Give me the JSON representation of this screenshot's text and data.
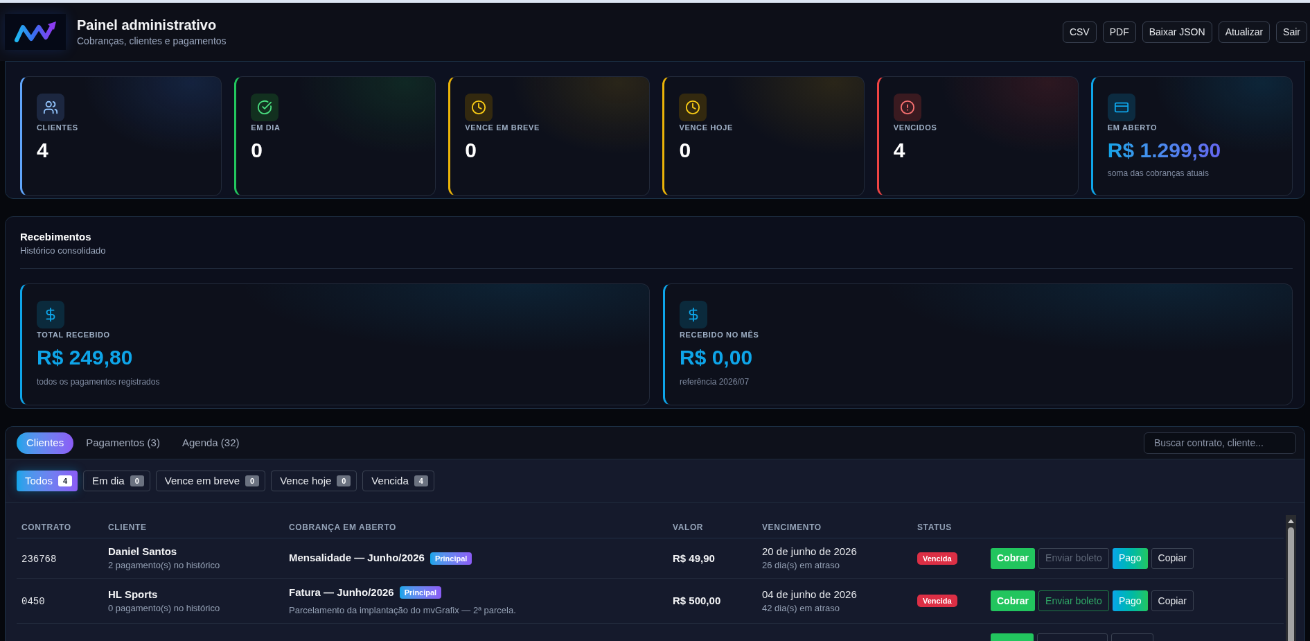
{
  "header": {
    "title": "Painel administrativo",
    "subtitle": "Cobranças, clientes e pagamentos",
    "buttons": [
      "CSV",
      "PDF",
      "Baixar JSON",
      "Atualizar",
      "Sair"
    ]
  },
  "stats": [
    {
      "kind": "clients",
      "label": "CLIENTES",
      "value": "4"
    },
    {
      "kind": "ok",
      "label": "EM DIA",
      "value": "0"
    },
    {
      "kind": "soon",
      "label": "VENCE EM BREVE",
      "value": "0"
    },
    {
      "kind": "today",
      "label": "VENCE HOJE",
      "value": "0"
    },
    {
      "kind": "overdue",
      "label": "VENCIDOS",
      "value": "4"
    },
    {
      "kind": "open",
      "label": "EM ABERTO",
      "value": "R$ 1.299,90",
      "note": "soma das cobranças atuais"
    }
  ],
  "receipts": {
    "title": "Recebimentos",
    "subtitle": "Histórico consolidado",
    "cards": [
      {
        "label": "TOTAL RECEBIDO",
        "value": "R$ 249,80",
        "note": "todos os pagamentos registrados"
      },
      {
        "label": "RECEBIDO NO MÊS",
        "value": "R$ 0,00",
        "note": "referência 2026/07"
      }
    ]
  },
  "tabs": [
    {
      "label": "Clientes",
      "selected": true
    },
    {
      "label": "Pagamentos (3)",
      "selected": false
    },
    {
      "label": "Agenda (32)",
      "selected": false
    }
  ],
  "search": {
    "placeholder": "Buscar contrato, cliente..."
  },
  "filters": [
    {
      "label": "Todos",
      "count": "4",
      "selected": true
    },
    {
      "label": "Em dia",
      "count": "0",
      "selected": false
    },
    {
      "label": "Vence em breve",
      "count": "0",
      "selected": false
    },
    {
      "label": "Vence hoje",
      "count": "0",
      "selected": false
    },
    {
      "label": "Vencida",
      "count": "4",
      "selected": false
    }
  ],
  "table": {
    "columns": [
      "CONTRATO",
      "CLIENTE",
      "COBRANÇA EM ABERTO",
      "VALOR",
      "VENCIMENTO",
      "STATUS"
    ],
    "rows": [
      {
        "contract": "236768",
        "client": "Daniel Santos",
        "client_note": "2 pagamento(s) no histórico",
        "charge": "Mensalidade — Junho/2026",
        "tag": {
          "label": "Principal",
          "kind": "main"
        },
        "value": "R$ 49,90",
        "due": "20 de junho de 2026",
        "due_note": "26 dia(s) em atraso",
        "status": {
          "label": "Vencida",
          "kind": "overdue"
        },
        "actions": [
          {
            "label": "Cobrar",
            "kind": "charge",
            "disabled": false
          },
          {
            "label": "Enviar boleto",
            "kind": "send",
            "disabled": true
          },
          {
            "label": "Pago",
            "kind": "paid",
            "disabled": false
          },
          {
            "label": "Copiar",
            "kind": "copy",
            "disabled": false
          }
        ]
      },
      {
        "contract": "0450",
        "client": "HL Sports",
        "client_note": "0 pagamento(s) no histórico",
        "charge": "Fatura — Junho/2026",
        "tag": {
          "label": "Principal",
          "kind": "main"
        },
        "description": "Parcelamento da implantação do mvGrafix — 2ª parcela.",
        "value": "R$ 500,00",
        "due": "04 de junho de 2026",
        "due_note": "42 dia(s) em atraso",
        "status": {
          "label": "Vencida",
          "kind": "overdue"
        },
        "actions": [
          {
            "label": "Cobrar",
            "kind": "charge",
            "disabled": false
          },
          {
            "label": "Enviar boleto",
            "kind": "send",
            "disabled": false
          },
          {
            "label": "Pago",
            "kind": "paid",
            "disabled": false
          },
          {
            "label": "Copiar",
            "kind": "copy",
            "disabled": false
          }
        ]
      },
      {
        "actions": [
          {
            "kind": "charge"
          },
          {
            "kind": "send"
          },
          {
            "kind": "copy"
          }
        ]
      }
    ]
  }
}
